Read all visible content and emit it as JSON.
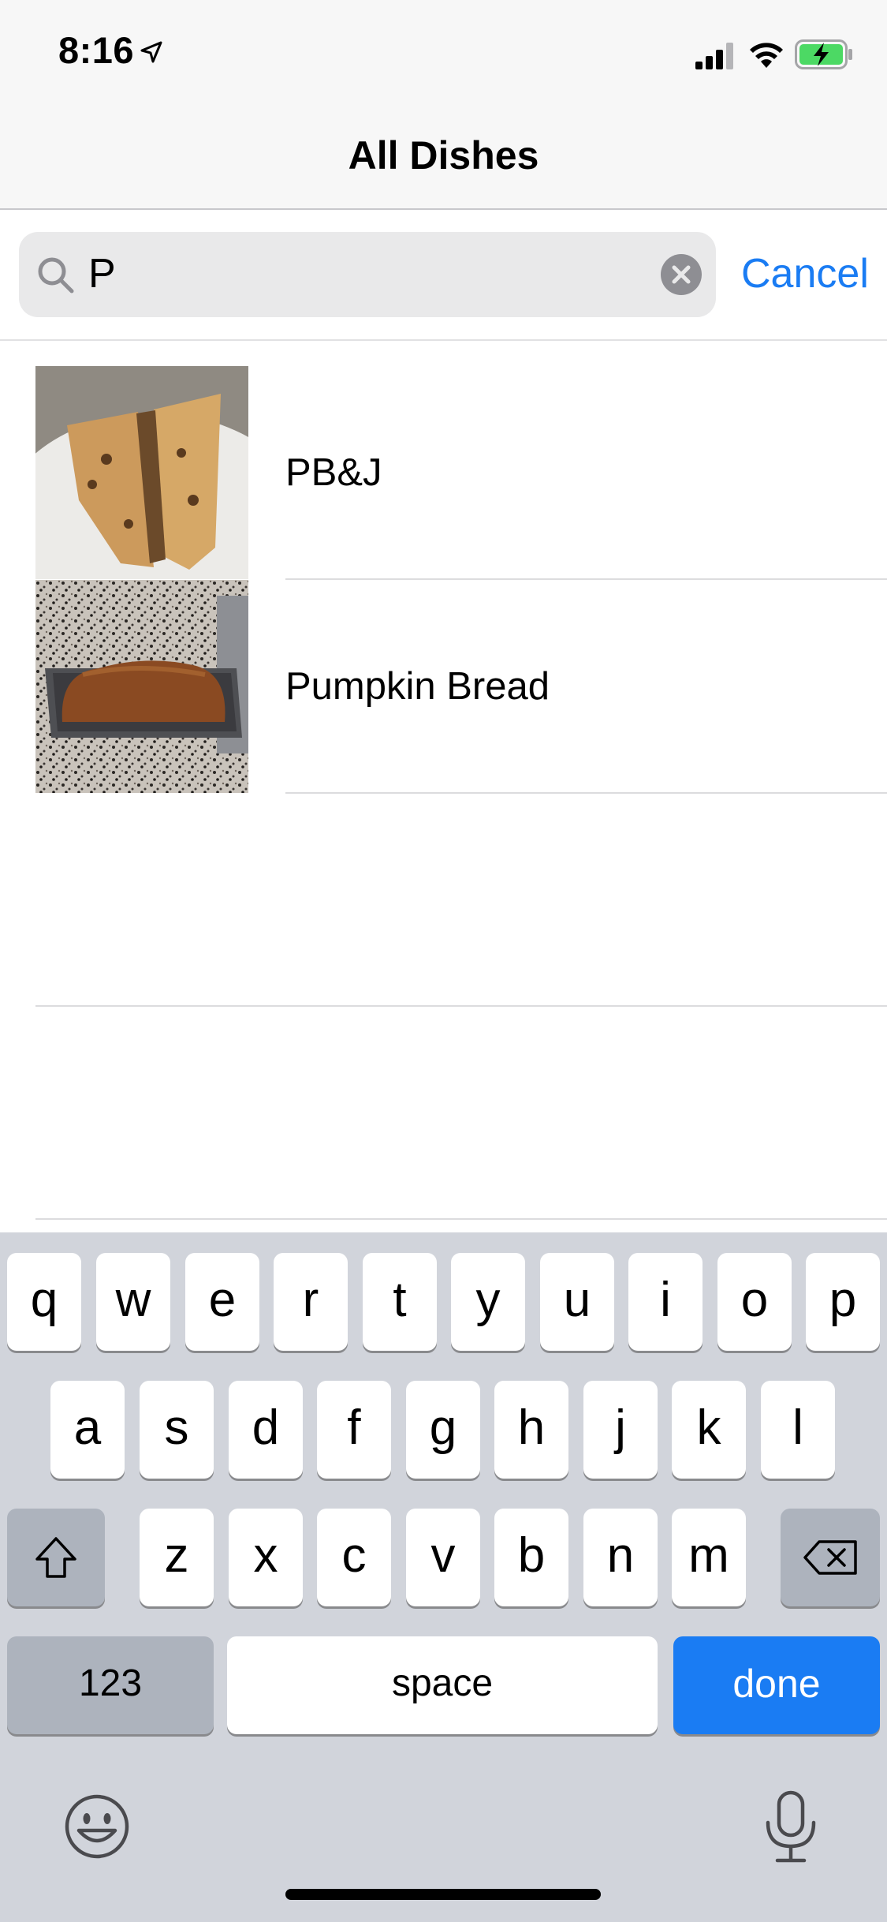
{
  "status_bar": {
    "time": "8:16"
  },
  "nav": {
    "title": "All Dishes"
  },
  "search": {
    "query": "P",
    "cancel_label": "Cancel"
  },
  "results": [
    {
      "name": "PB&J"
    },
    {
      "name": "Pumpkin Bread"
    }
  ],
  "keyboard": {
    "row1": [
      "q",
      "w",
      "e",
      "r",
      "t",
      "y",
      "u",
      "i",
      "o",
      "p"
    ],
    "row2": [
      "a",
      "s",
      "d",
      "f",
      "g",
      "h",
      "j",
      "k",
      "l"
    ],
    "row3": [
      "z",
      "x",
      "c",
      "v",
      "b",
      "n",
      "m"
    ],
    "numbers_label": "123",
    "space_label": "space",
    "done_label": "done"
  },
  "colors": {
    "accent": "#1a7cf3",
    "keyboard_bg": "#d1d4db",
    "battery_green": "#4cd964"
  }
}
